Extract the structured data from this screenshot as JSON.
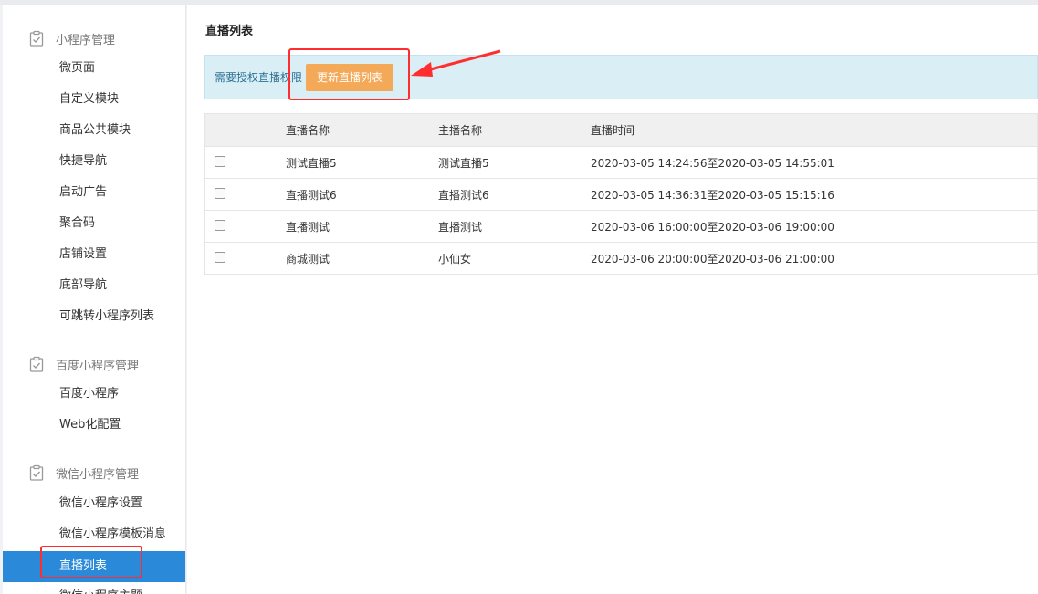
{
  "sidebar": {
    "groups": [
      {
        "title": "小程序管理",
        "items": [
          "微页面",
          "自定义模块",
          "商品公共模块",
          "快捷导航",
          "启动广告",
          "聚合码",
          "店铺设置",
          "底部导航",
          "可跳转小程序列表"
        ]
      },
      {
        "title": "百度小程序管理",
        "items": [
          "百度小程序",
          "Web化配置"
        ]
      },
      {
        "title": "微信小程序管理",
        "items": [
          "微信小程序设置",
          "微信小程序模板消息",
          "直播列表",
          "微信小程序主题"
        ]
      }
    ]
  },
  "main": {
    "title": "直播列表",
    "notice": {
      "text": "需要授权直播权限",
      "button": "更新直播列表"
    },
    "table": {
      "headers": [
        "直播名称",
        "主播名称",
        "直播时间"
      ],
      "rows": [
        {
          "name": "测试直播5",
          "anchor": "测试直播5",
          "time": "2020-03-05 14:24:56至2020-03-05 14:55:01"
        },
        {
          "name": "直播测试6",
          "anchor": "直播测试6",
          "time": "2020-03-05 14:36:31至2020-03-05 15:15:16"
        },
        {
          "name": "直播测试",
          "anchor": "直播测试",
          "time": "2020-03-06 16:00:00至2020-03-06 19:00:00"
        },
        {
          "name": "商城测试",
          "anchor": "小仙女",
          "time": "2020-03-06 20:00:00至2020-03-06 21:00:00"
        }
      ]
    }
  },
  "colors": {
    "accent": "#2a8ad9",
    "button": "#f3a957",
    "notice_bg": "#d9eef5",
    "highlight": "#ff2d2d"
  }
}
